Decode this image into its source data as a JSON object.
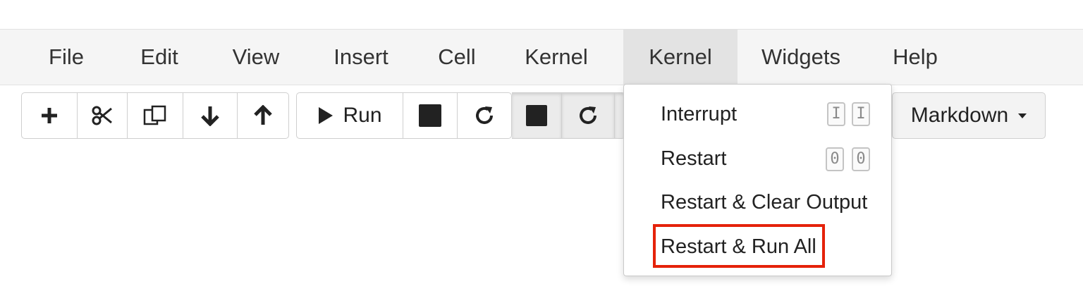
{
  "menubar": {
    "items": [
      {
        "label": "File"
      },
      {
        "label": "Edit"
      },
      {
        "label": "View"
      },
      {
        "label": "Insert"
      },
      {
        "label": "Cell"
      },
      {
        "label": "Kernel"
      },
      {
        "label": "Kernel",
        "state": "open"
      },
      {
        "label": "Widgets"
      },
      {
        "label": "Help"
      }
    ]
  },
  "toolbar": {
    "group1_icons": [
      "plus-icon",
      "scissors-icon",
      "copy-icon",
      "arrow-down-icon",
      "arrow-up-icon"
    ],
    "run_label": "Run",
    "group2_icons": [
      "play-icon",
      "stop-icon",
      "restart-icon"
    ],
    "group3_icons": [
      "stop-icon",
      "restart-icon"
    ],
    "cell_type": "Markdown"
  },
  "kernel_menu": {
    "items": [
      {
        "label": "Interrupt",
        "shortcut": [
          "I",
          "I"
        ]
      },
      {
        "label": "Restart",
        "shortcut": [
          "0",
          "0"
        ]
      },
      {
        "label": "Restart & Clear Output"
      },
      {
        "label": "Restart & Run All",
        "highlighted": true
      }
    ],
    "highlight_color": "#e5220a"
  },
  "colors": {
    "menubar_bg": "#f5f5f5",
    "open_menu_bg": "#e3e3e3",
    "border": "#cfcfcf"
  }
}
